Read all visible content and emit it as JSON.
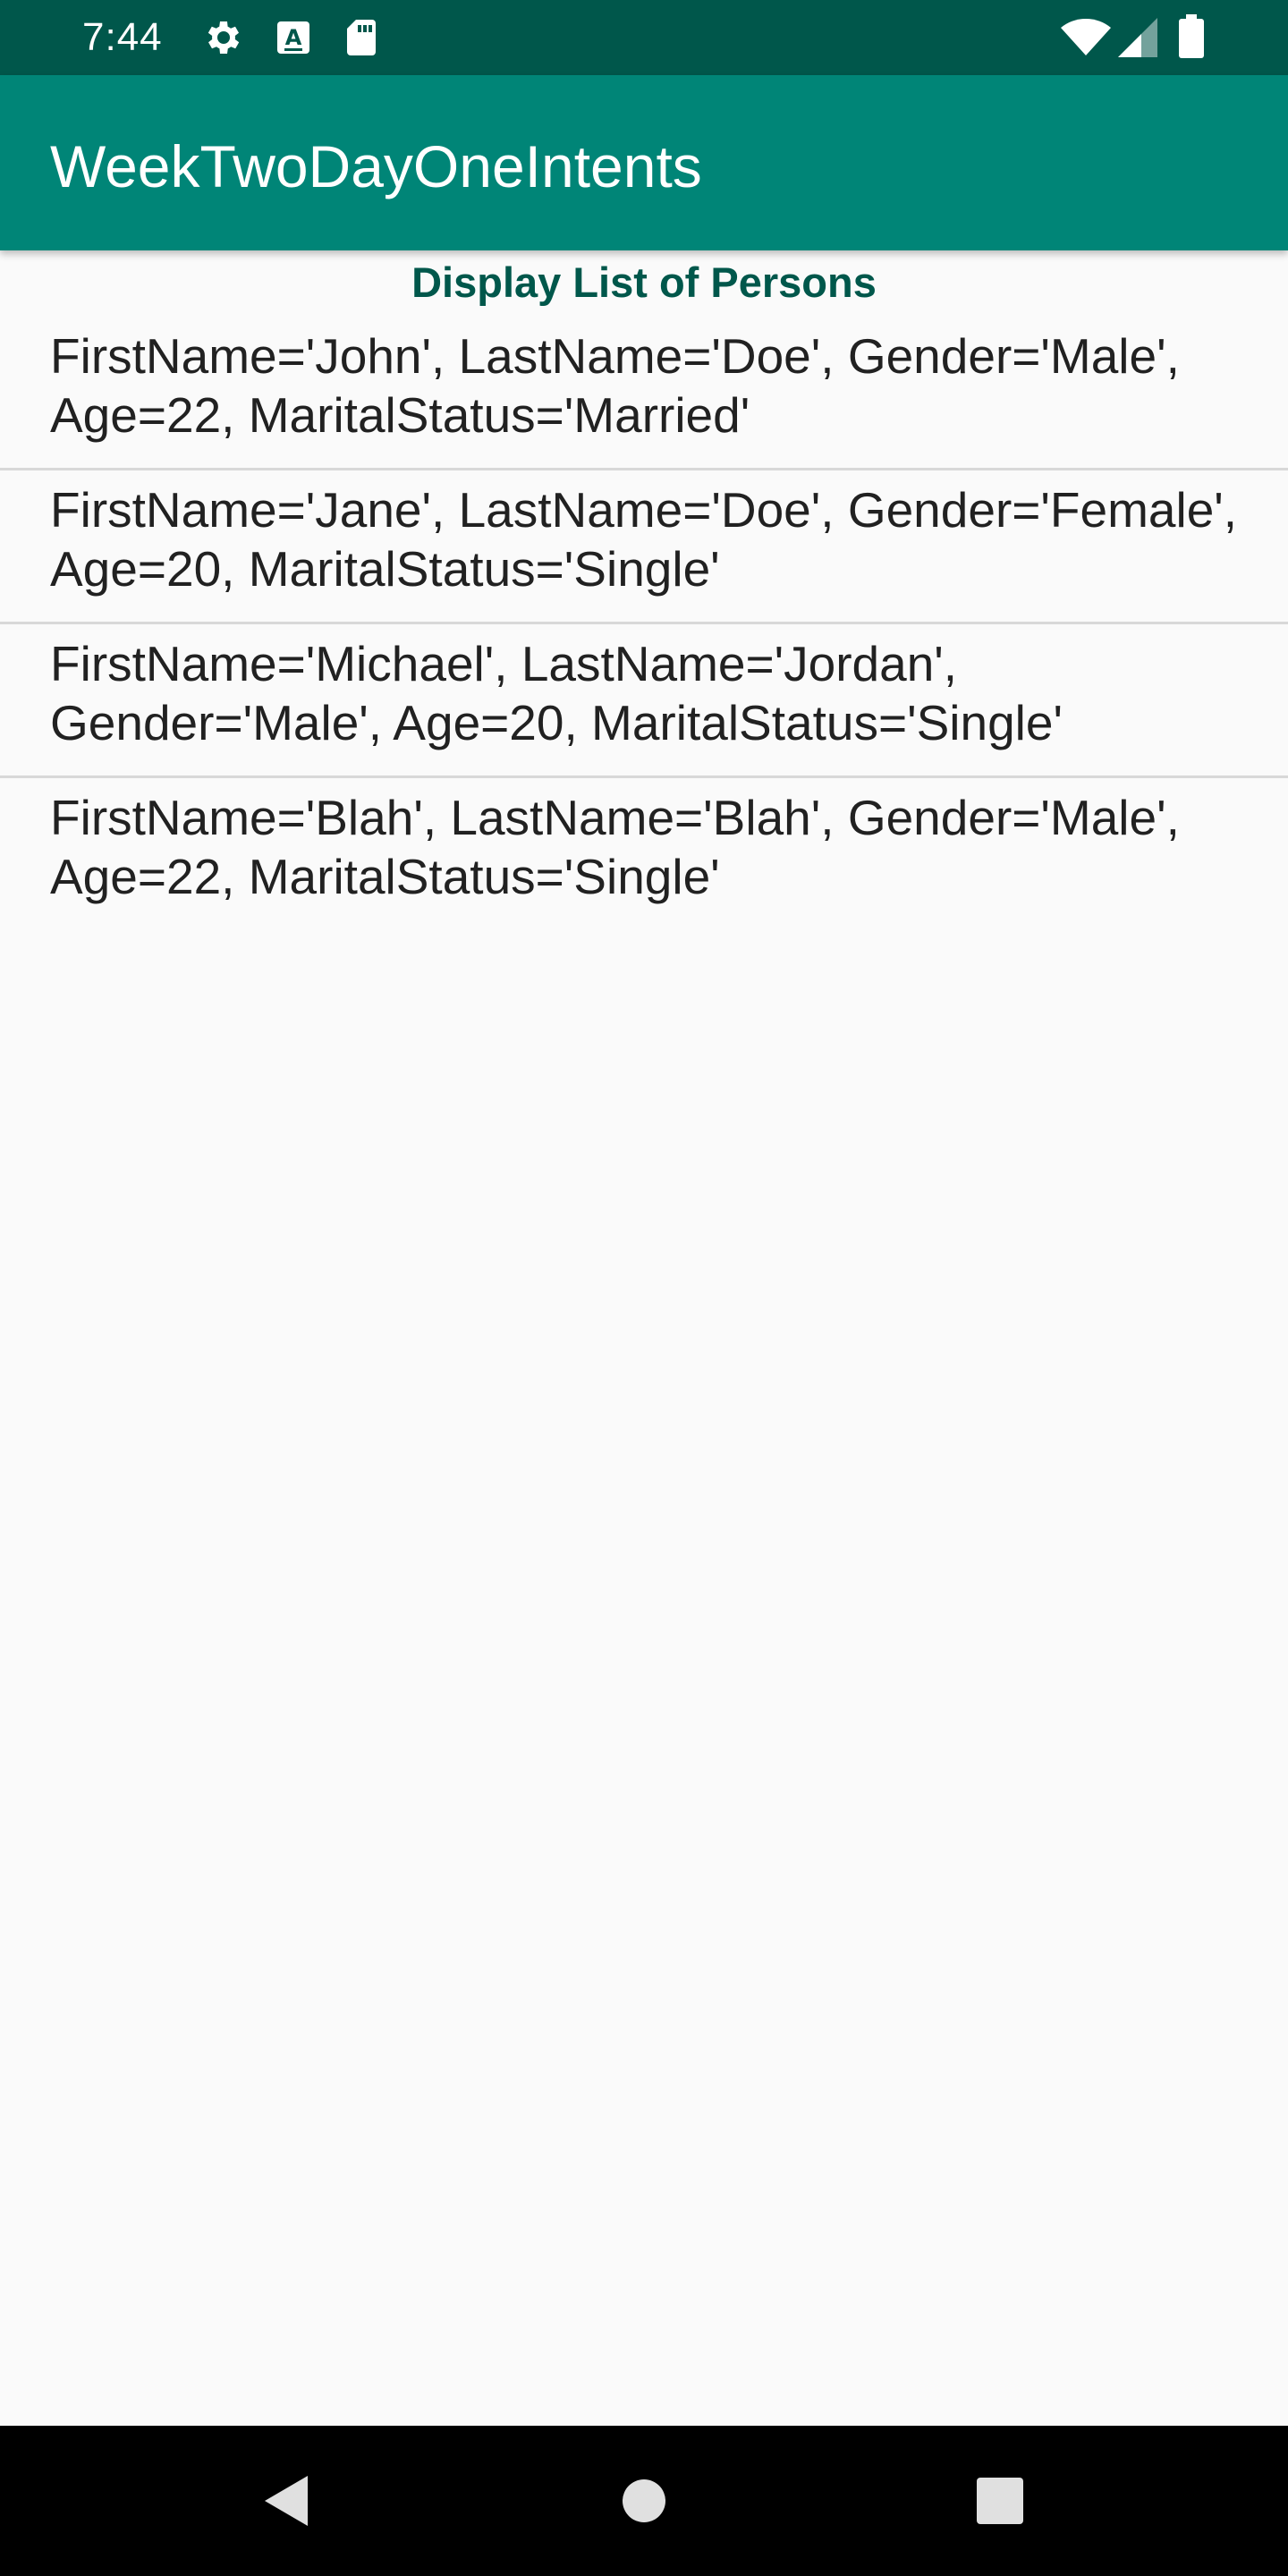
{
  "status_bar": {
    "time": "7:44",
    "left_icons": [
      "gear-icon",
      "a-box-icon",
      "sd-card-icon"
    ],
    "right_icons": [
      "wifi-icon",
      "cell-signal-icon",
      "battery-icon"
    ]
  },
  "app_bar": {
    "title": "WeekTwoDayOneIntents"
  },
  "heading": "Display List of Persons",
  "persons": [
    {
      "line1": "FirstName='John', LastName='Doe', Gender='Male',",
      "line2": "Age=22, MaritalStatus='Married'"
    },
    {
      "line1": "FirstName='Jane', LastName='Doe', Gender='Female',",
      "line2": "Age=20, MaritalStatus='Single'"
    },
    {
      "line1": "FirstName='Michael', LastName='Jordan',",
      "line2": "Gender='Male', Age=20, MaritalStatus='Single'"
    },
    {
      "line1": "FirstName='Blah', LastName='Blah', Gender='Male',",
      "line2": "Age=22, MaritalStatus='Single'"
    }
  ],
  "nav_bar": {
    "buttons": [
      "back-icon",
      "home-icon",
      "recents-icon"
    ]
  },
  "colors": {
    "status_bar": "#00574b",
    "app_bar": "#008577",
    "heading": "#00574b",
    "background": "#fafafa"
  }
}
